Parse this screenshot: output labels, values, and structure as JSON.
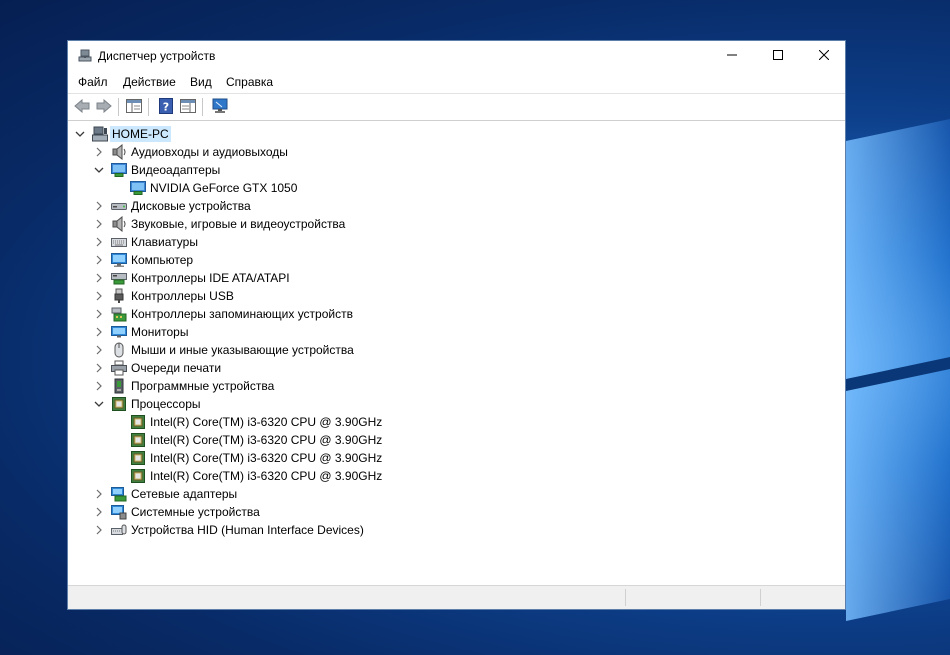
{
  "window": {
    "title": "Диспетчер устройств",
    "controls": {
      "minimize": "minimize-icon",
      "maximize": "maximize-icon",
      "close": "close-icon"
    }
  },
  "menu": [
    "Файл",
    "Действие",
    "Вид",
    "Справка"
  ],
  "toolbar": [
    "back-arrow-icon",
    "forward-arrow-icon",
    "properties-pane-icon",
    "help-icon",
    "details-pane-icon",
    "scan-monitor-icon"
  ],
  "tree": {
    "root": "HOME-PC",
    "nodes": [
      {
        "label": "Аудиовходы и аудиовыходы",
        "icon": "speaker-icon",
        "expanded": false
      },
      {
        "label": "Видеоадаптеры",
        "icon": "display-adapter-icon",
        "expanded": true
      },
      {
        "label": "NVIDIA GeForce GTX 1050",
        "icon": "display-adapter-icon",
        "child": true
      },
      {
        "label": "Дисковые устройства",
        "icon": "disk-drive-icon",
        "expanded": false
      },
      {
        "label": "Звуковые, игровые и видеоустройства",
        "icon": "speaker-icon",
        "expanded": false
      },
      {
        "label": "Клавиатуры",
        "icon": "keyboard-icon",
        "expanded": false
      },
      {
        "label": "Компьютер",
        "icon": "computer-icon",
        "expanded": false
      },
      {
        "label": "Контроллеры IDE ATA/ATAPI",
        "icon": "ide-controller-icon",
        "expanded": false
      },
      {
        "label": "Контроллеры USB",
        "icon": "usb-icon",
        "expanded": false
      },
      {
        "label": "Контроллеры запоминающих устройств",
        "icon": "storage-controller-icon",
        "expanded": false
      },
      {
        "label": "Мониторы",
        "icon": "monitor-icon",
        "expanded": false
      },
      {
        "label": "Мыши и иные указывающие устройства",
        "icon": "mouse-icon",
        "expanded": false
      },
      {
        "label": "Очереди печати",
        "icon": "printer-icon",
        "expanded": false
      },
      {
        "label": "Программные устройства",
        "icon": "software-device-icon",
        "expanded": false
      },
      {
        "label": "Процессоры",
        "icon": "processor-icon",
        "expanded": true
      },
      {
        "label": "Intel(R) Core(TM) i3-6320 CPU @ 3.90GHz",
        "icon": "processor-icon",
        "child": true
      },
      {
        "label": "Intel(R) Core(TM) i3-6320 CPU @ 3.90GHz",
        "icon": "processor-icon",
        "child": true
      },
      {
        "label": "Intel(R) Core(TM) i3-6320 CPU @ 3.90GHz",
        "icon": "processor-icon",
        "child": true
      },
      {
        "label": "Intel(R) Core(TM) i3-6320 CPU @ 3.90GHz",
        "icon": "processor-icon",
        "child": true
      },
      {
        "label": "Сетевые адаптеры",
        "icon": "network-adapter-icon",
        "expanded": false
      },
      {
        "label": "Системные устройства",
        "icon": "system-device-icon",
        "expanded": false
      },
      {
        "label": "Устройства HID (Human Interface Devices)",
        "icon": "hid-icon",
        "expanded": false
      }
    ]
  },
  "colors": {
    "selection": "#cce8ff",
    "chevron": "#6b6b6b",
    "window_border": "#5d7ea8"
  }
}
